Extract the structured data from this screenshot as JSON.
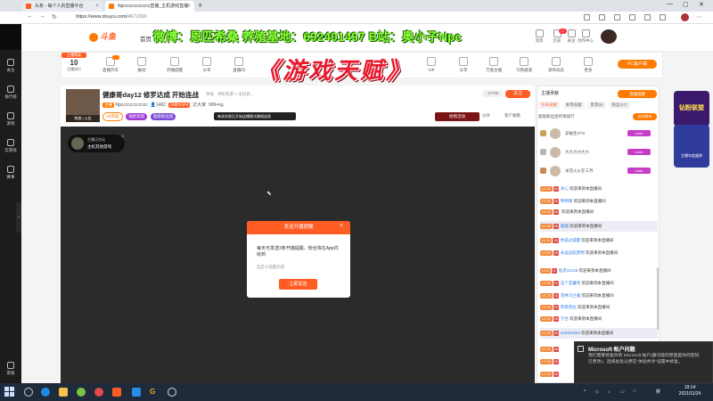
{
  "browser": {
    "tabs": [
      {
        "title": "头条 - 每个人的直播平台"
      },
      {
        "title": "Npcccccccccccc直播_主机游戏直播"
      }
    ],
    "new_tab": "+",
    "url_host": "https://www.douyu.com/",
    "url_path": "4672396",
    "window_controls": [
      "—",
      "▢",
      "✕"
    ]
  },
  "overlay": {
    "text": "微博：恩匹希桑 养殖基地：692401497 B站：奥小子Npc",
    "game_title": "《游戏天赋》"
  },
  "header": {
    "home": "首页",
    "fen": "分",
    "top_icons": [
      "消息",
      "历史",
      "关注",
      "创作中心",
      "开播"
    ]
  },
  "leftbar": {
    "items": [
      "关注",
      "排行榜",
      "游戏",
      "云游戏",
      "赛事"
    ],
    "bottom_item": "客服"
  },
  "category_bar": {
    "level_tag": "主播等级",
    "level_num": "10",
    "level_label": "主播排行",
    "items": [
      "直播开车",
      "触动",
      "开播提醒",
      "分享",
      "直播间",
      "游戏",
      "鱼吧",
      "直播",
      "福利",
      "VIP",
      "分享",
      "万能主播",
      "乌鸦通道",
      "发布动态",
      "更多"
    ],
    "pc_app": "PC客户端"
  },
  "room": {
    "title": "健康哥day12 修罗达成 开始连战",
    "report": "举报",
    "category": "单机热游 > 主机其...",
    "host_badge": "主播",
    "host_name": "Npcccccccccccc",
    "followers": "1462",
    "rank_tag": "日榜TOP4",
    "extra": "达大家",
    "heat": "999+kg",
    "tags": [
      "V5等级",
      "福星高照",
      "超级粉丝团"
    ],
    "avatar_caption": "热度 | 公告",
    "tooltip": "每关失败后开始连播模式确保连续",
    "room_num": "10796",
    "follow": "关注",
    "promo": "抢购活动",
    "share": "分享",
    "client": "客户端看"
  },
  "player": {
    "mini_title": "主播正在玩",
    "mini_sub": "主机其他游戏",
    "close": "×"
  },
  "modal": {
    "title": "发送开播提醒",
    "close": "×",
    "body": "每天可发送3条开播提醒，粉丝将在App内收到",
    "check": "自定义提醒内容",
    "button": "立即发送"
  },
  "right_panel": {
    "rank_title": "主播贡献",
    "live_btn": "直播提醒",
    "tabs": [
      "今日贡献",
      "本周贡献",
      "贵宾(5)",
      "粉丝(47)"
    ],
    "fan_text": "超级粉丝团有钱排行",
    "fan_btn": "成为粉丝",
    "ranking": [
      {
        "name": "穿破生XTS",
        "badge": "noob"
      },
      {
        "name": "大大力力大大",
        "badge": "noob"
      },
      {
        "name": "米花火火在三月",
        "badge": "noob"
      }
    ],
    "chat": [
      {
        "lv": "LV 31",
        "rk": "04",
        "user": "冰心",
        "msg": "欢迎来到本直播间"
      },
      {
        "lv": "LV 24",
        "rk": "05",
        "user": "鸭鸭啊",
        "msg": "欢迎来到本直播间"
      },
      {
        "lv": "LV 13",
        "rk": "08",
        "user": "",
        "msg": "欢迎来到本直播间"
      },
      {
        "lv": "LV 26",
        "rk": "08",
        "user": "摆摆",
        "msg": "欢迎来到本直播间"
      },
      {
        "lv": "LV 11",
        "rk": "08",
        "user": "你说过提醒",
        "msg": "欢迎来到本直播间"
      },
      {
        "lv": "LV 20",
        "rk": "05",
        "user": "永远追踪梦想",
        "msg": "欢迎来到本直播间"
      },
      {
        "lv": "LV 8",
        "rk": "01",
        "user": "低音12138",
        "msg": "欢迎来到本直播间"
      },
      {
        "lv": "LV 20",
        "rk": "04",
        "user": "这个是暮色",
        "msg": "欢迎来到本直播间"
      },
      {
        "lv": "LV 24",
        "rk": "03",
        "user": "克林乌兰雅",
        "msg": "欢迎来到本直播间"
      },
      {
        "lv": "LV 19",
        "rk": "05",
        "user": "阿斯克拉",
        "msg": "欢迎来到本直播间"
      },
      {
        "lv": "LV 21",
        "rk": "06",
        "user": "宁合",
        "msg": "欢迎来到本直播间"
      },
      {
        "lv": "LV 26",
        "rk": "05",
        "user": "SUN01823",
        "msg": "欢迎来到本直播间"
      },
      {
        "lv": "LV 21",
        "rk": "08",
        "user": "",
        "msg": ""
      },
      {
        "lv": "LV 18",
        "rk": "05",
        "user": "",
        "msg": ""
      },
      {
        "lv": "LV 20",
        "rk": "06",
        "user": "",
        "msg": ""
      }
    ]
  },
  "promos": {
    "a": "钻粉联盟",
    "b": "主播年度盛典"
  },
  "toast": {
    "title": "Microsoft 帐户问题",
    "body": "我们需要修复你的 Microsoft 帐户(最可能的原因是你的密码已更改)。选择此处以便在\"体验共享\"设置中修复。"
  },
  "taskbar": {
    "lang": "拼",
    "time": "19:14",
    "date": "2021/11/24"
  },
  "colors": {
    "accent": "#ff5d23",
    "overlay_green": "#8bff3a",
    "title_red": "#e8192c"
  }
}
